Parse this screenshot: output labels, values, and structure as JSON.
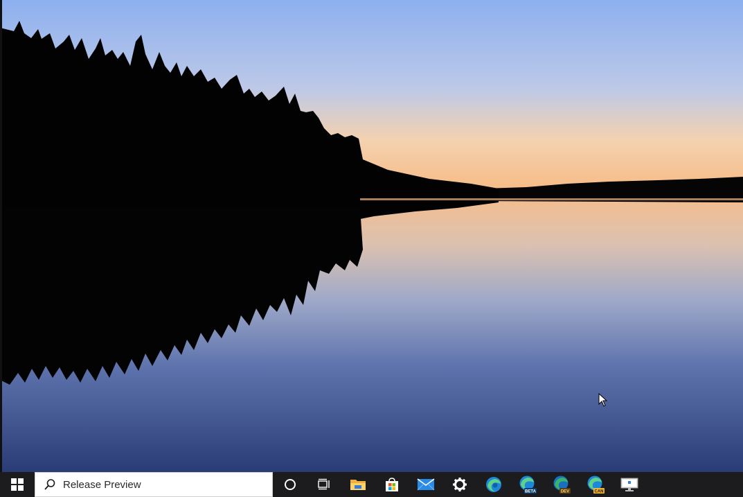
{
  "desktop": {
    "wallpaper": "lake-sunset-wallpaper",
    "colors": {
      "sky_top": "#8fb1ee",
      "sky_horizon": "#f6c48f",
      "water_bottom": "#2b3f78",
      "treeline": "#030303"
    }
  },
  "taskbar": {
    "background": "#1c1c1e",
    "start_icon": "windows-logo-icon",
    "search": {
      "placeholder": "Release Preview",
      "icon": "search-icon"
    },
    "pinned": [
      {
        "name": "cortana-button",
        "icon": "cortana-ring-icon"
      },
      {
        "name": "task-view-button",
        "icon": "task-view-icon"
      },
      {
        "name": "file-explorer-button",
        "icon": "folder-icon"
      },
      {
        "name": "microsoft-store-button",
        "icon": "store-bag-icon"
      },
      {
        "name": "mail-button",
        "icon": "mail-icon"
      },
      {
        "name": "settings-button",
        "icon": "gear-icon"
      },
      {
        "name": "edge-button",
        "icon": "edge-icon"
      },
      {
        "name": "edge-beta-button",
        "icon": "edge-beta-icon",
        "badge": "BETA"
      },
      {
        "name": "edge-dev-button",
        "icon": "edge-dev-icon",
        "badge": "DEV"
      },
      {
        "name": "edge-canary-button",
        "icon": "edge-canary-icon",
        "badge": "CAN"
      },
      {
        "name": "remote-desktop-button",
        "icon": "monitor-icon"
      }
    ]
  }
}
